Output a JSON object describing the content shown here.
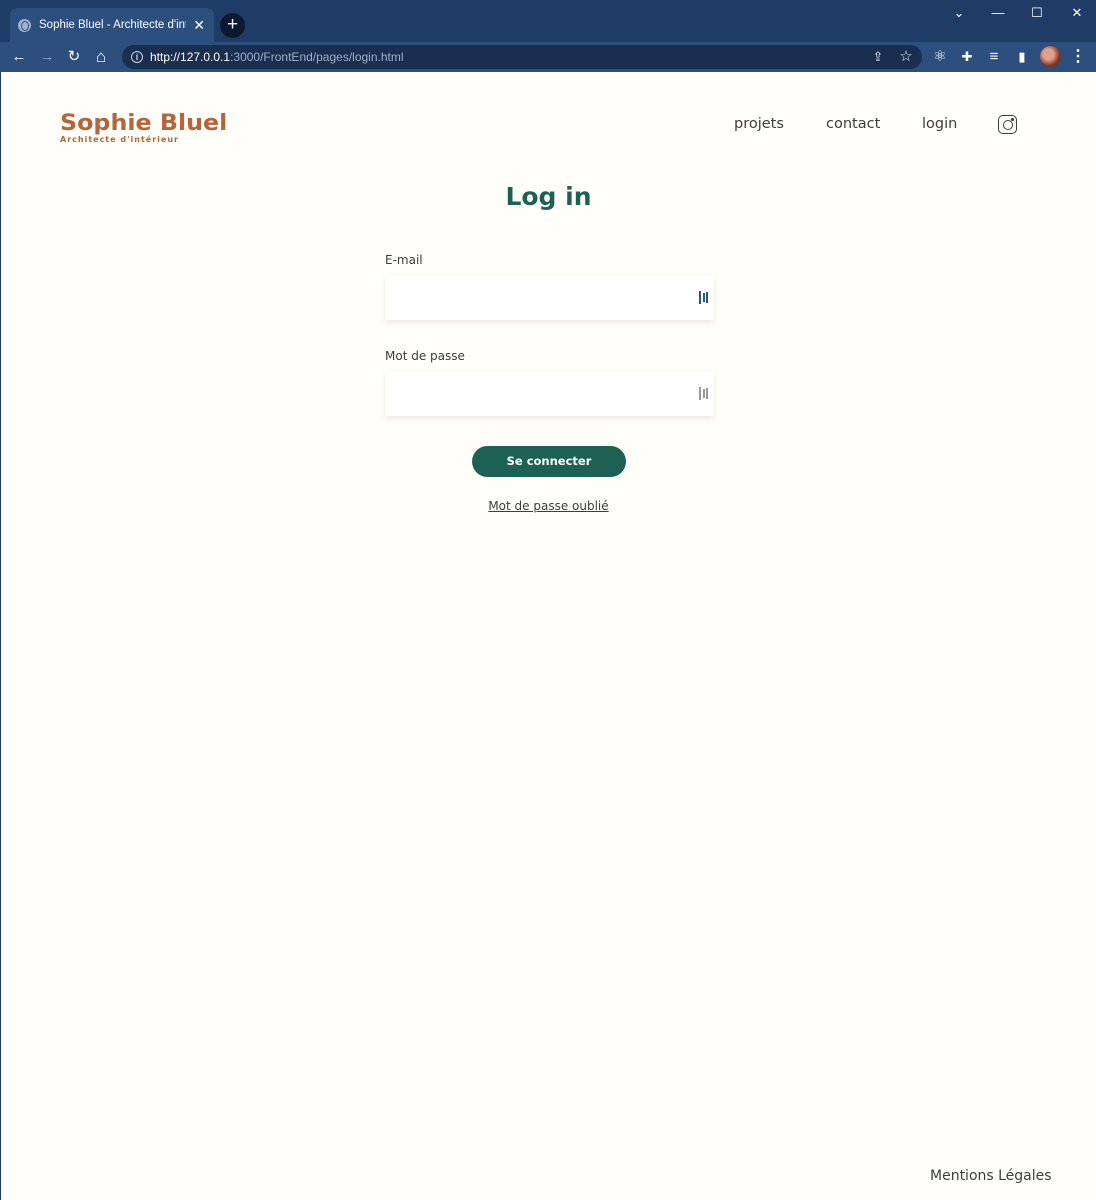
{
  "browser": {
    "tab_title": "Sophie Bluel - Architecte d'intérieur",
    "tab_close": "✕",
    "new_tab": "+",
    "window_controls": {
      "chevron": "⌄",
      "minimize": "—",
      "maximize": "☐",
      "close": "✕"
    },
    "url_host": "http://127.0.0.1",
    "url_path": ":3000/FrontEnd/pages/login.html",
    "info_symbol": "i",
    "nav_glyphs": {
      "back": "←",
      "forward": "→",
      "reload": "↻",
      "home": "⌂"
    },
    "omnibox_glyphs": {
      "share": "⇪",
      "bookmark": "☆"
    },
    "ext_glyphs": {
      "react": "⚛",
      "puzzle": "✚",
      "media": "≡",
      "sidepanel": "▮"
    },
    "menu_glyph": "⋮"
  },
  "site": {
    "logo_title": "Sophie Bluel",
    "logo_subtitle": "Architecte d'intérieur",
    "nav": {
      "projects": "projets",
      "contact": "contact",
      "login": "login"
    }
  },
  "login": {
    "title": "Log in",
    "email_label": "E-mail",
    "email_value": "",
    "password_label": "Mot de passe",
    "password_value": "",
    "submit_label": "Se connecter",
    "forgot_label": "Mot de passe oublié"
  },
  "footer": {
    "legal": "Mentions Légales"
  },
  "colors": {
    "brand": "#b1663c",
    "primary": "#1d6154",
    "text": "#3d3d3d",
    "background": "#fffef8",
    "browser_frame": "#1f3c66"
  }
}
